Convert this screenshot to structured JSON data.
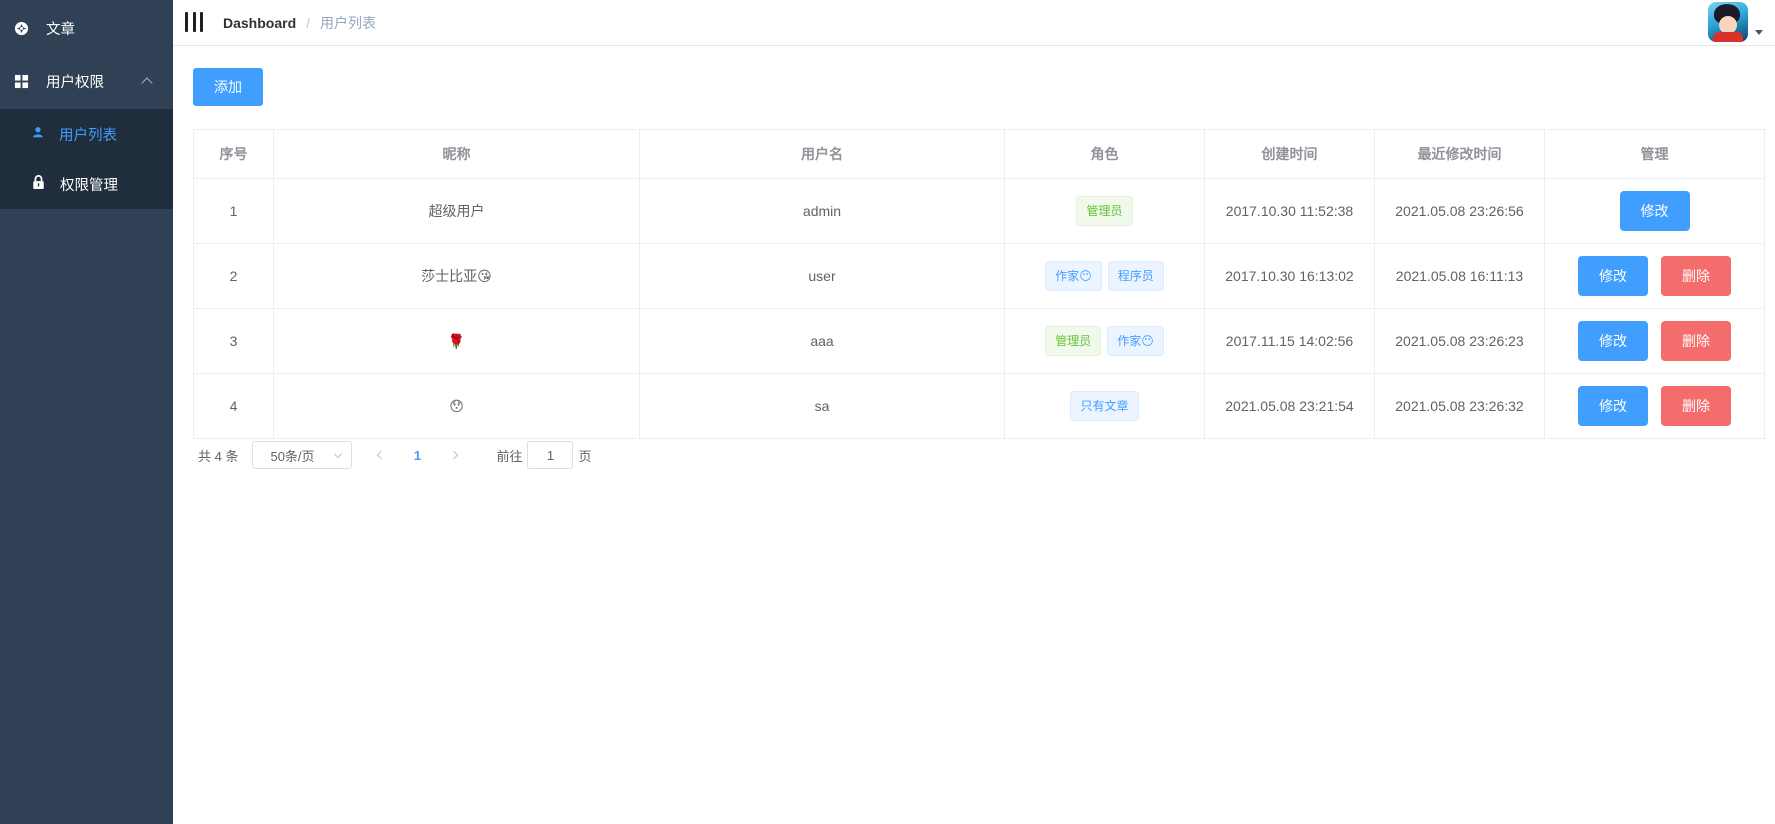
{
  "sidebar": {
    "items": [
      {
        "label": "文章",
        "icon": "compass-icon"
      },
      {
        "label": "用户权限",
        "icon": "grid-icon",
        "expanded": true
      }
    ],
    "subitems": [
      {
        "label": "用户列表",
        "icon": "user-icon",
        "active": true
      },
      {
        "label": "权限管理",
        "icon": "lock-icon"
      }
    ]
  },
  "header": {
    "breadcrumb_root": "Dashboard",
    "breadcrumb_sep": "/",
    "breadcrumb_current": "用户列表"
  },
  "toolbar": {
    "add_label": "添加"
  },
  "table": {
    "columns": [
      "序号",
      "昵称",
      "用户名",
      "角色",
      "创建时间",
      "最近修改时间",
      "管理"
    ],
    "rows": [
      {
        "index": "1",
        "nickname": "超级用户",
        "username": "admin",
        "roles": [
          {
            "label": "管理员",
            "type": "success"
          }
        ],
        "created": "2017.10.30 11:52:38",
        "modified": "2021.05.08 23:26:56",
        "edit": "修改",
        "delete": null
      },
      {
        "index": "2",
        "nickname": "莎士比亚😘",
        "username": "user",
        "roles": [
          {
            "label": "作家😶",
            "type": "primary"
          },
          {
            "label": "程序员",
            "type": "primary"
          }
        ],
        "created": "2017.10.30 16:13:02",
        "modified": "2021.05.08 16:11:13",
        "edit": "修改",
        "delete": "删除"
      },
      {
        "index": "3",
        "nickname": "🌹",
        "username": "aaa",
        "roles": [
          {
            "label": "管理员",
            "type": "success"
          },
          {
            "label": "作家😶",
            "type": "primary"
          }
        ],
        "created": "2017.11.15 14:02:56",
        "modified": "2021.05.08 23:26:23",
        "edit": "修改",
        "delete": "删除"
      },
      {
        "index": "4",
        "nickname": "😯",
        "username": "sa",
        "roles": [
          {
            "label": "只有文章",
            "type": "primary"
          }
        ],
        "created": "2021.05.08 23:21:54",
        "modified": "2021.05.08 23:26:32",
        "edit": "修改",
        "delete": "删除"
      }
    ]
  },
  "pagination": {
    "total": "共 4 条",
    "page_size": "50条/页",
    "current_page": "1",
    "goto_prefix": "前往",
    "goto_value": "1",
    "goto_suffix": "页"
  },
  "colors": {
    "sidebar_bg": "#304156",
    "submenu_bg": "#1f2d3d",
    "primary": "#409eff",
    "danger": "#f56c6c"
  }
}
